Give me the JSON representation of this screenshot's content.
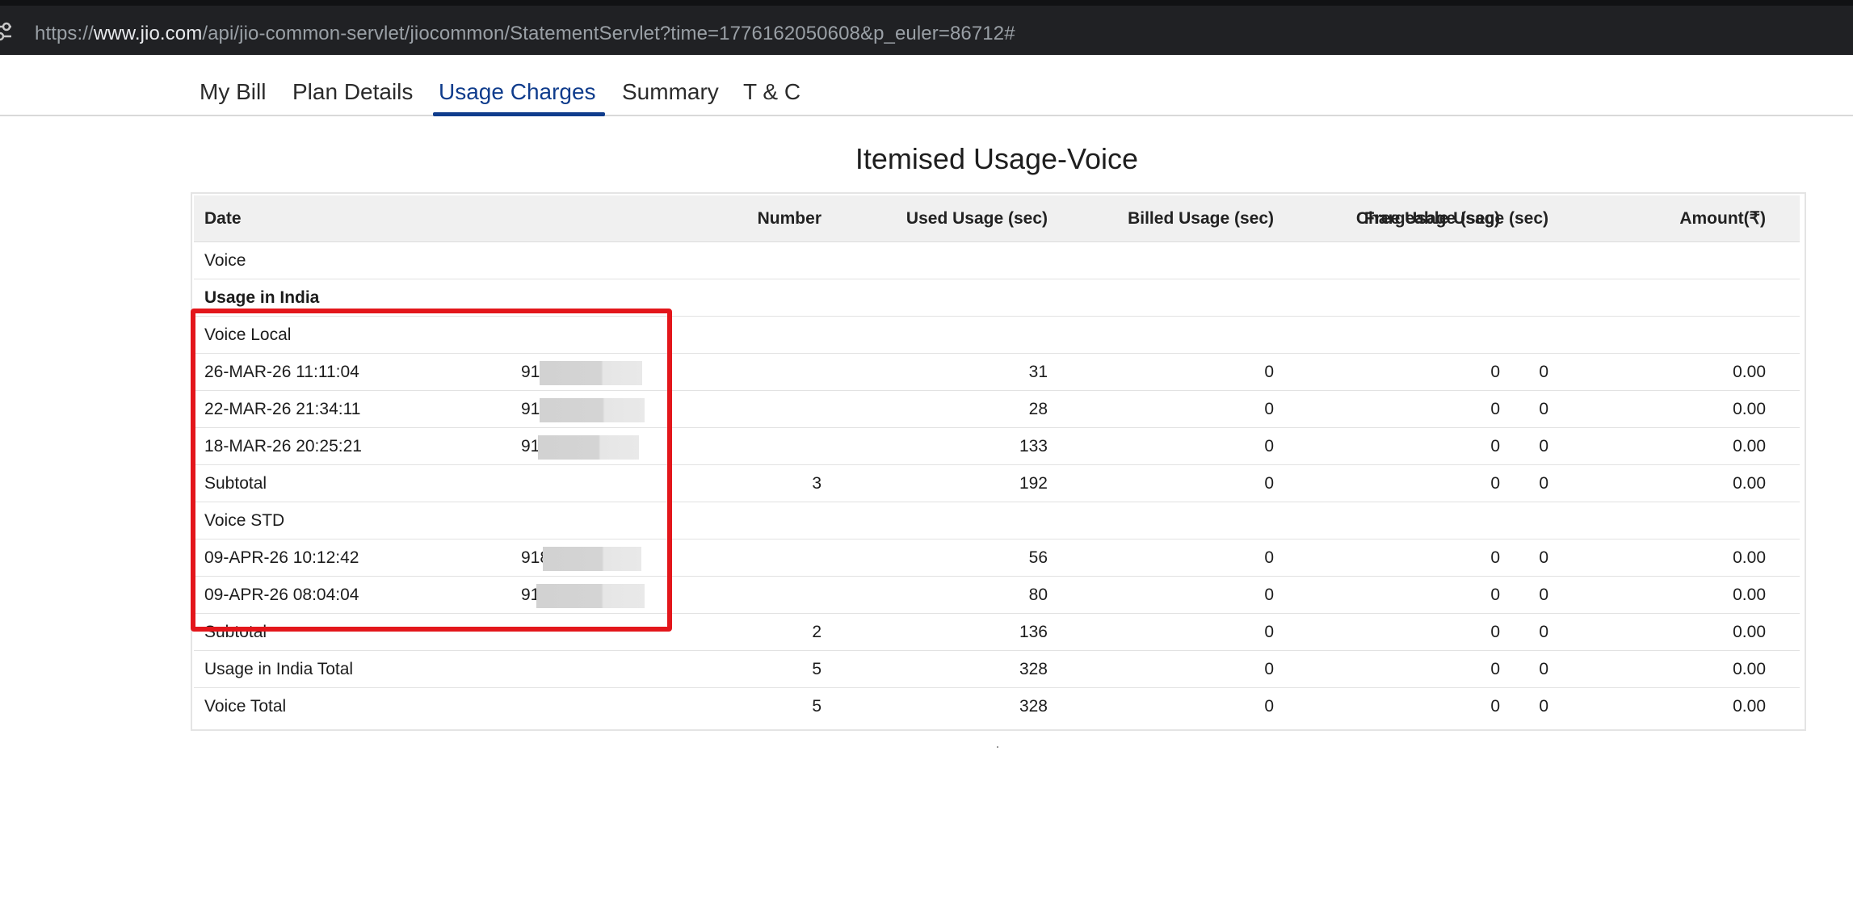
{
  "browser": {
    "url_prefix": "https://",
    "url_host": "www.jio.com",
    "url_path": "/api/jio-common-servlet/jiocommon/StatementServlet?time=1776162050608&p_euler=86712#"
  },
  "tabs": [
    {
      "label": "My Bill"
    },
    {
      "label": "Plan Details"
    },
    {
      "label": "Usage Charges",
      "active": true
    },
    {
      "label": "Summary"
    },
    {
      "label": "T & C"
    }
  ],
  "title": "Itemised Usage-Voice",
  "table": {
    "headers": {
      "date": "Date",
      "number": "Number",
      "used": "Used Usage (sec)",
      "billed": "Billed Usage (sec)",
      "free": "Free Usage (sec)",
      "chargeable": "Chargeable Usage (sec)",
      "amount": "Amount(₹)"
    },
    "rows": [
      {
        "date": "Voice"
      },
      {
        "date": "Usage in India"
      },
      {
        "date": "Voice Local"
      },
      {
        "date": "26-MAR-26 11:11:04",
        "number": "91",
        "used": "31",
        "billed": "0",
        "free": "0",
        "chargeable": "0",
        "amount": "0.00"
      },
      {
        "date": "22-MAR-26 21:34:11",
        "number": "91",
        "used": "28",
        "billed": "0",
        "free": "0",
        "chargeable": "0",
        "amount": "0.00"
      },
      {
        "date": "18-MAR-26 20:25:21",
        "number": "91",
        "used": "133",
        "billed": "0",
        "free": "0",
        "chargeable": "0",
        "amount": "0.00"
      },
      {
        "date": "Subtotal",
        "number": "3",
        "used": "192",
        "billed": "0",
        "free": "0",
        "chargeable": "0",
        "amount": "0.00"
      },
      {
        "date": "Voice STD"
      },
      {
        "date": "09-APR-26 10:12:42",
        "number": "918",
        "used": "56",
        "billed": "0",
        "free": "0",
        "chargeable": "0",
        "amount": "0.00"
      },
      {
        "date": "09-APR-26 08:04:04",
        "number": "91",
        "used": "80",
        "billed": "0",
        "free": "0",
        "chargeable": "0",
        "amount": "0.00"
      },
      {
        "date": "Subtotal",
        "number": "2",
        "used": "136",
        "billed": "0",
        "free": "0",
        "chargeable": "0",
        "amount": "0.00"
      },
      {
        "date": "Usage in India Total",
        "number": "5",
        "used": "328",
        "billed": "0",
        "free": "0",
        "chargeable": "0",
        "amount": "0.00"
      },
      {
        "date": "Voice Total",
        "number": "5",
        "used": "328",
        "billed": "0",
        "free": "0",
        "chargeable": "0",
        "amount": "0.00"
      }
    ]
  },
  "icons": {
    "site_info": "tune-icon"
  },
  "colors": {
    "accent": "#0f3c8c",
    "highlight": "#e3161b",
    "header_bg": "#f0f0f0",
    "address_bar": "#202124"
  }
}
